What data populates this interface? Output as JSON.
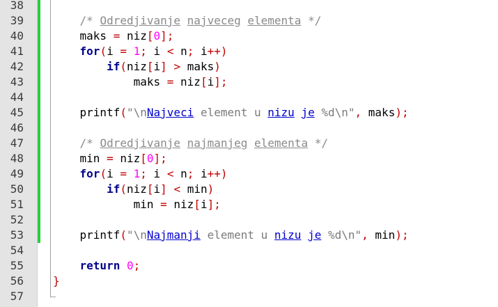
{
  "editor": {
    "lines": [
      {
        "n": "38",
        "changed": true,
        "tokens": []
      },
      {
        "n": "39",
        "changed": true,
        "tokens": [
          [
            "plain",
            "    "
          ],
          [
            "cm",
            "/* "
          ],
          [
            "cmu",
            "Odredjivanje"
          ],
          [
            "cm",
            " "
          ],
          [
            "cmu",
            "najveceg"
          ],
          [
            "cm",
            " "
          ],
          [
            "cmu",
            "elementa"
          ],
          [
            "cm",
            " */"
          ]
        ]
      },
      {
        "n": "40",
        "changed": true,
        "tokens": [
          [
            "plain",
            "    maks "
          ],
          [
            "op",
            "="
          ],
          [
            "plain",
            " niz"
          ],
          [
            "op",
            "["
          ],
          [
            "num",
            "0"
          ],
          [
            "op",
            "];"
          ]
        ]
      },
      {
        "n": "41",
        "changed": true,
        "tokens": [
          [
            "plain",
            "    "
          ],
          [
            "kw",
            "for"
          ],
          [
            "op",
            "("
          ],
          [
            "plain",
            "i "
          ],
          [
            "op",
            "="
          ],
          [
            "plain",
            " "
          ],
          [
            "num",
            "1"
          ],
          [
            "op",
            ";"
          ],
          [
            "plain",
            " i "
          ],
          [
            "op",
            "<"
          ],
          [
            "plain",
            " n"
          ],
          [
            "op",
            ";"
          ],
          [
            "plain",
            " i"
          ],
          [
            "op",
            "++)"
          ]
        ]
      },
      {
        "n": "42",
        "changed": true,
        "tokens": [
          [
            "plain",
            "        "
          ],
          [
            "kw",
            "if"
          ],
          [
            "op",
            "("
          ],
          [
            "plain",
            "niz"
          ],
          [
            "op",
            "["
          ],
          [
            "plain",
            "i"
          ],
          [
            "op",
            "]"
          ],
          [
            "plain",
            " "
          ],
          [
            "op",
            ">"
          ],
          [
            "plain",
            " maks"
          ],
          [
            "op",
            ")"
          ]
        ]
      },
      {
        "n": "43",
        "changed": true,
        "tokens": [
          [
            "plain",
            "            maks "
          ],
          [
            "op",
            "="
          ],
          [
            "plain",
            " niz"
          ],
          [
            "op",
            "["
          ],
          [
            "plain",
            "i"
          ],
          [
            "op",
            "];"
          ]
        ]
      },
      {
        "n": "44",
        "changed": true,
        "tokens": []
      },
      {
        "n": "45",
        "changed": true,
        "tokens": [
          [
            "plain",
            "    printf"
          ],
          [
            "op",
            "("
          ],
          [
            "str",
            "\"\\n"
          ],
          [
            "spell",
            "Najveci"
          ],
          [
            "str",
            " element u "
          ],
          [
            "spell",
            "nizu"
          ],
          [
            "str",
            " "
          ],
          [
            "spell",
            "je"
          ],
          [
            "str",
            " %d\\n\""
          ],
          [
            "op",
            ","
          ],
          [
            "plain",
            " maks"
          ],
          [
            "op",
            ");"
          ]
        ]
      },
      {
        "n": "46",
        "changed": true,
        "tokens": []
      },
      {
        "n": "47",
        "changed": true,
        "tokens": [
          [
            "plain",
            "    "
          ],
          [
            "cm",
            "/* "
          ],
          [
            "cmu",
            "Odredjivanje"
          ],
          [
            "cm",
            " "
          ],
          [
            "cmu",
            "najmanjeg"
          ],
          [
            "cm",
            " "
          ],
          [
            "cmu",
            "elementa"
          ],
          [
            "cm",
            " */"
          ]
        ]
      },
      {
        "n": "48",
        "changed": true,
        "tokens": [
          [
            "plain",
            "    min "
          ],
          [
            "op",
            "="
          ],
          [
            "plain",
            " niz"
          ],
          [
            "op",
            "["
          ],
          [
            "num",
            "0"
          ],
          [
            "op",
            "];"
          ]
        ]
      },
      {
        "n": "49",
        "changed": true,
        "tokens": [
          [
            "plain",
            "    "
          ],
          [
            "kw",
            "for"
          ],
          [
            "op",
            "("
          ],
          [
            "plain",
            "i "
          ],
          [
            "op",
            "="
          ],
          [
            "plain",
            " "
          ],
          [
            "num",
            "1"
          ],
          [
            "op",
            ";"
          ],
          [
            "plain",
            " i "
          ],
          [
            "op",
            "<"
          ],
          [
            "plain",
            " n"
          ],
          [
            "op",
            ";"
          ],
          [
            "plain",
            " i"
          ],
          [
            "op",
            "++)"
          ]
        ]
      },
      {
        "n": "50",
        "changed": true,
        "tokens": [
          [
            "plain",
            "        "
          ],
          [
            "kw",
            "if"
          ],
          [
            "op",
            "("
          ],
          [
            "plain",
            "niz"
          ],
          [
            "op",
            "["
          ],
          [
            "plain",
            "i"
          ],
          [
            "op",
            "]"
          ],
          [
            "plain",
            " "
          ],
          [
            "op",
            "<"
          ],
          [
            "plain",
            " min"
          ],
          [
            "op",
            ")"
          ]
        ]
      },
      {
        "n": "51",
        "changed": true,
        "tokens": [
          [
            "plain",
            "            min "
          ],
          [
            "op",
            "="
          ],
          [
            "plain",
            " niz"
          ],
          [
            "op",
            "["
          ],
          [
            "plain",
            "i"
          ],
          [
            "op",
            "];"
          ]
        ]
      },
      {
        "n": "52",
        "changed": true,
        "tokens": []
      },
      {
        "n": "53",
        "changed": true,
        "tokens": [
          [
            "plain",
            "    printf"
          ],
          [
            "op",
            "("
          ],
          [
            "str",
            "\"\\n"
          ],
          [
            "spell",
            "Najmanji"
          ],
          [
            "str",
            " element u "
          ],
          [
            "spell",
            "nizu"
          ],
          [
            "str",
            " "
          ],
          [
            "spell",
            "je"
          ],
          [
            "str",
            " %d\\n\""
          ],
          [
            "op",
            ","
          ],
          [
            "plain",
            " min"
          ],
          [
            "op",
            ");"
          ]
        ]
      },
      {
        "n": "54",
        "changed": false,
        "tokens": []
      },
      {
        "n": "55",
        "changed": false,
        "tokens": [
          [
            "plain",
            "    "
          ],
          [
            "kw",
            "return"
          ],
          [
            "plain",
            " "
          ],
          [
            "num",
            "0"
          ],
          [
            "op",
            ";"
          ]
        ]
      },
      {
        "n": "56",
        "changed": false,
        "tokens": [
          [
            "op",
            "}"
          ]
        ]
      },
      {
        "n": "57",
        "changed": false,
        "tokens": []
      }
    ]
  },
  "colors": {
    "keyword": "#00008b",
    "operator": "#c00000",
    "number": "#ff00ff",
    "comment": "#8a8a8a",
    "string": "#7a7a7a",
    "spellcheck_underline": "#0000cc",
    "change_bar": "#2ecc40",
    "gutter_bg": "#e4e4e4"
  }
}
